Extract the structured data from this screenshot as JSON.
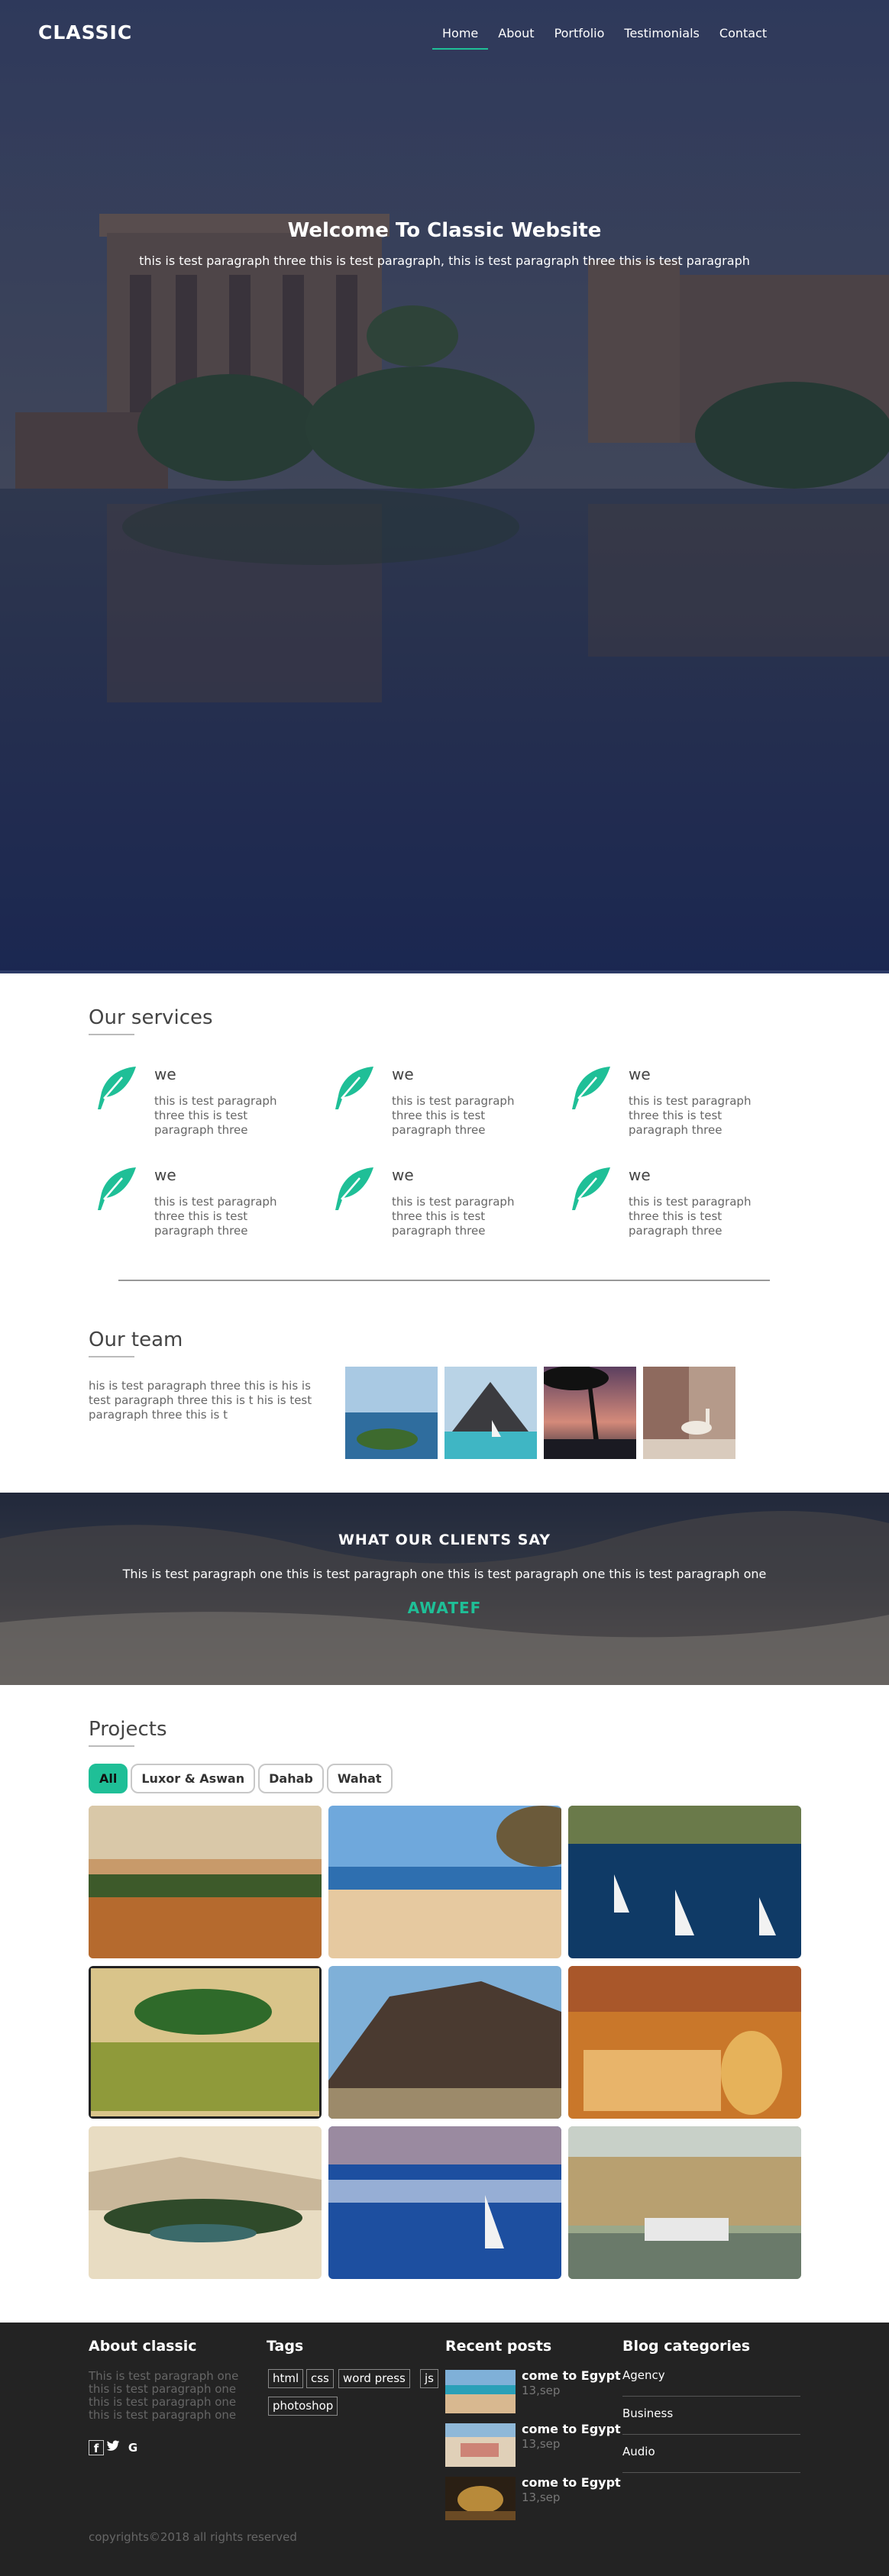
{
  "brand": "CLASSIC",
  "nav": [
    "Home",
    "About",
    "Portfolio",
    "Testimonials",
    "Contact"
  ],
  "hero": {
    "title": "Welcome To Classic Website",
    "subtitle": "this is test paragraph three this is test paragraph, this is test paragraph three this is test paragraph"
  },
  "services": {
    "title": "Our services",
    "items": [
      {
        "name": "we",
        "text": "this is test paragraph three this is test paragraph three"
      },
      {
        "name": "we",
        "text": "this is test paragraph three this is test paragraph three"
      },
      {
        "name": "we",
        "text": "this is test paragraph three this is test paragraph three"
      },
      {
        "name": "we",
        "text": "this is test paragraph three this is test paragraph three"
      },
      {
        "name": "we",
        "text": "this is test paragraph three this is test paragraph three"
      },
      {
        "name": "we",
        "text": "this is test paragraph three this is test paragraph three"
      }
    ],
    "icon": "feather-icon"
  },
  "team": {
    "title": "Our team",
    "text": "his is test paragraph three this is his is test paragraph three this is t his is test paragraph three this is t"
  },
  "testimonials": {
    "title": "WHAT OUR CLIENTS SAY",
    "quote": "This is test paragraph one this is test paragraph one this is test paragraph one this is test paragraph one",
    "name": "AWATEF"
  },
  "projects": {
    "title": "Projects",
    "filters": [
      "All",
      "Luxor & Aswan",
      "Dahab",
      "Wahat"
    ],
    "active_filter": "All"
  },
  "footer": {
    "about_title": "About classic",
    "about_text": "This is test paragraph one this is test paragraph one this is test paragraph one this is test paragraph one",
    "social": [
      "f",
      "twitter-icon",
      "G"
    ],
    "tags_title": "Tags",
    "tags": [
      "html",
      "css",
      "word press",
      "js",
      "photoshop"
    ],
    "posts_title": "Recent posts",
    "posts": [
      {
        "title": "come to Egypt",
        "date": "13,sep"
      },
      {
        "title": "come to Egypt",
        "date": "13,sep"
      },
      {
        "title": "come to Egypt",
        "date": "13,sep"
      }
    ],
    "categories_title": "Blog categories",
    "categories": [
      "Agency",
      "Business",
      "Audio"
    ],
    "copyright": "copyrights©2018 all rights reserved"
  },
  "colors": {
    "accent": "#1fbf97",
    "footer_bg": "#232323",
    "hero_tint": "#24325e"
  }
}
